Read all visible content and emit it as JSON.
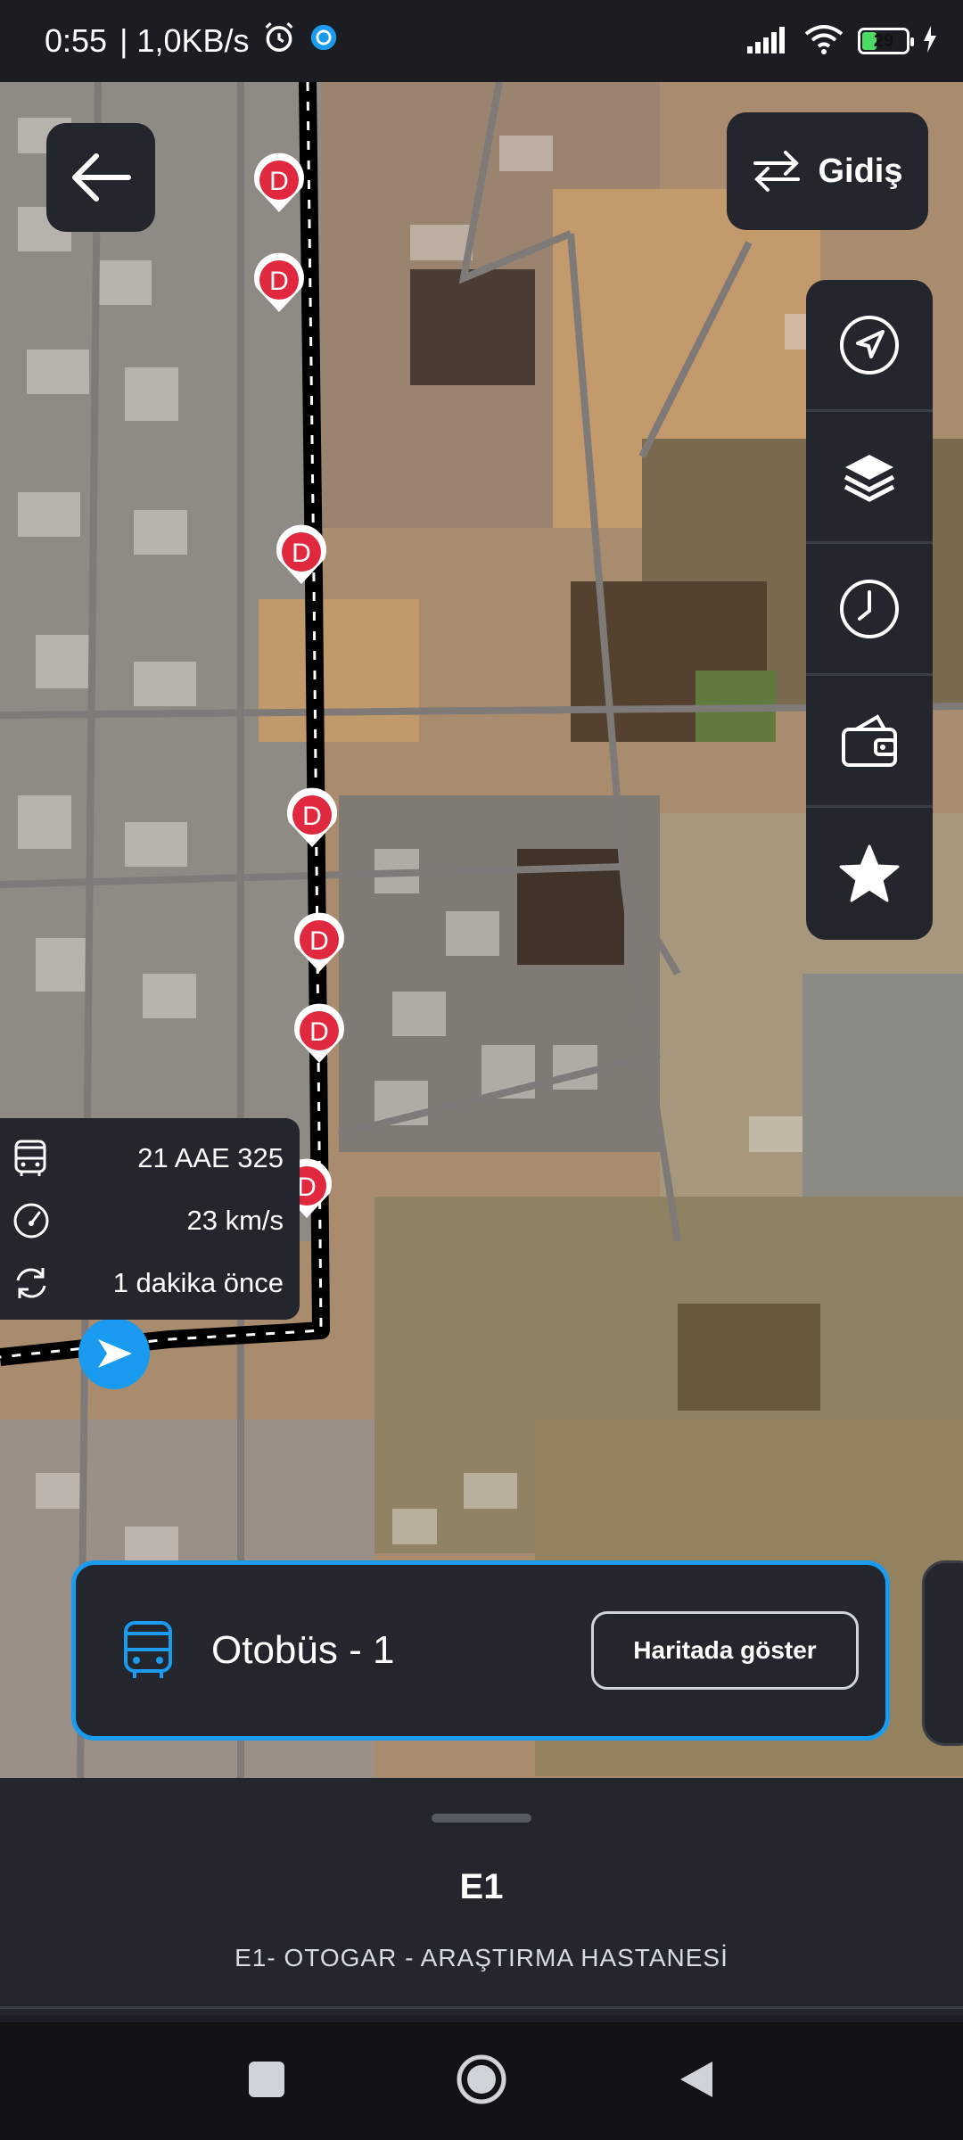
{
  "status_bar": {
    "time": "0:55",
    "network_speed": "| 1,0KB/s",
    "battery": "29"
  },
  "map": {
    "stop_marker_letter": "D",
    "route_color": "#000000",
    "stop_color": "#e0283e"
  },
  "header": {
    "direction_label": "Gidiş"
  },
  "right_panel": {
    "items": [
      "navigate-icon",
      "layers-icon",
      "clock-icon",
      "wallet-icon",
      "star-icon"
    ]
  },
  "vehicle_info": {
    "plate": "21 AAE 325",
    "speed": "23 km/s",
    "updated": "1 dakika önce"
  },
  "bus_card": {
    "label": "Otobüs - 1",
    "show_button": "Haritada göster",
    "accent": "#1a9bf0"
  },
  "sheet": {
    "route_code": "E1",
    "route_name": "E1- OTOGAR - ARAŞTIRMA HASTANESİ"
  }
}
